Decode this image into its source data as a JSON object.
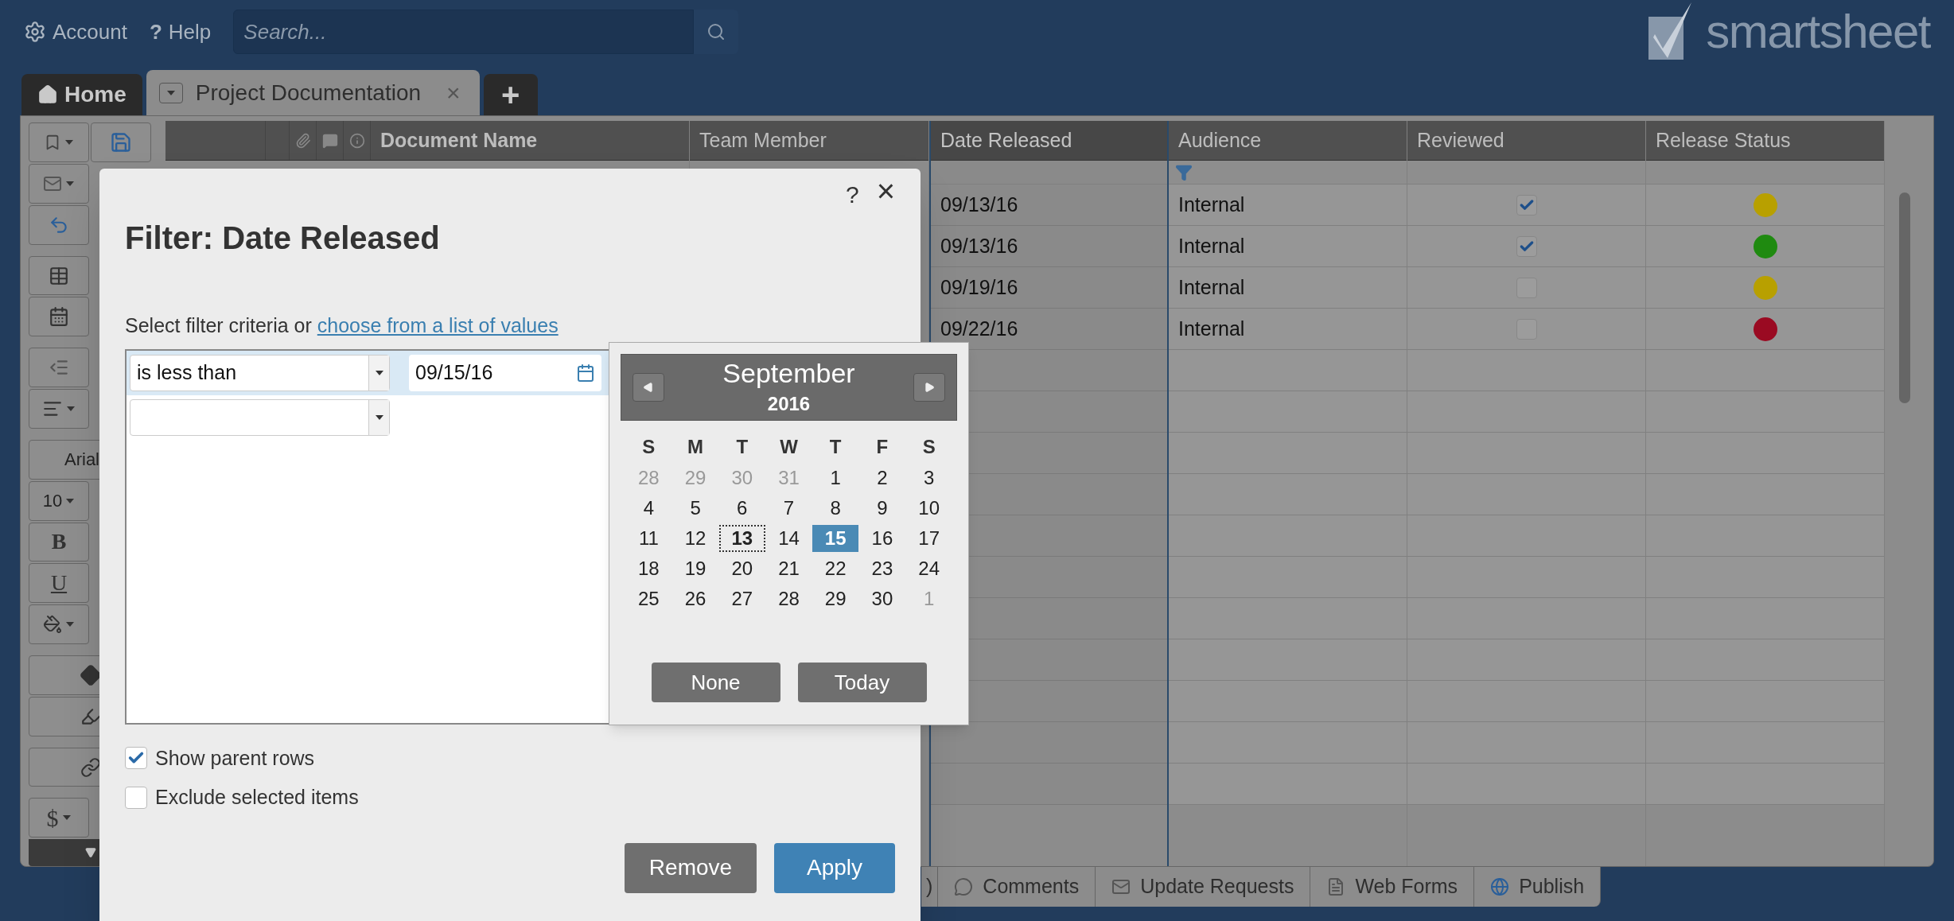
{
  "top_bar": {
    "account": "Account",
    "help_glyph": "?",
    "help": "Help",
    "search": {
      "placeholder": "Search..."
    },
    "logo": "smartsheet"
  },
  "tabs": [
    {
      "kind": "home",
      "label": "Home",
      "selected": false
    },
    {
      "kind": "sheet",
      "label": "Project Documentation",
      "close": "×",
      "selected": true
    },
    {
      "kind": "add",
      "label": "+",
      "selected": false
    }
  ],
  "toolbar": {
    "font": "Arial",
    "size": "10",
    "bold": "B",
    "underline": "U",
    "currency": "$"
  },
  "grid": {
    "columns": [
      {
        "label": "Document Name",
        "selected": false
      },
      {
        "label": "Team Member",
        "selected": false
      },
      {
        "label": "Date Released",
        "selected": true,
        "filtered": false
      },
      {
        "label": "Audience",
        "selected": false,
        "filtered": true
      },
      {
        "label": "Reviewed",
        "selected": false,
        "filtered": false
      },
      {
        "label": "Release Status",
        "selected": false,
        "filtered": false
      }
    ],
    "rows": [
      {
        "date_released": "09/13/16",
        "audience": "Internal",
        "reviewed": true,
        "color": "#b8a000"
      },
      {
        "date_released": "09/13/16",
        "audience": "Internal",
        "reviewed": true,
        "color": "#1f8a10"
      },
      {
        "date_released": "09/19/16",
        "audience": "Internal",
        "reviewed": false,
        "color": "#b8a000"
      },
      {
        "date_released": "09/22/16",
        "audience": "Internal",
        "reviewed": false,
        "color": "#9a0a22"
      }
    ]
  },
  "bottom_tabs": [
    {
      "kind": "attachments",
      "label": ")"
    },
    {
      "kind": "comments",
      "label": "Comments"
    },
    {
      "kind": "update",
      "label": "Update Requests"
    },
    {
      "kind": "forms",
      "label": "Web Forms"
    },
    {
      "kind": "publish",
      "label": "Publish"
    }
  ],
  "dialog": {
    "help": "?",
    "close": "×",
    "title": "Filter: Date Released",
    "prompt": "Select filter criteria or ",
    "link": "choose from a list of values",
    "conditions": [
      {
        "operator": "is less than",
        "value": "09/15/16",
        "selected": true
      },
      {
        "selected": false
      }
    ],
    "options": [
      {
        "label": "Show parent rows",
        "checked": true
      },
      {
        "label": "Exclude selected items",
        "checked": false
      }
    ],
    "buttons": [
      {
        "kind": "secondary",
        "label": "Remove"
      },
      {
        "kind": "primary",
        "label": "Apply"
      }
    ]
  },
  "calendar": {
    "month": "September",
    "year": "2016",
    "weekdays": [
      "S",
      "M",
      "T",
      "W",
      "T",
      "F",
      "S"
    ],
    "days": [
      {
        "label": "28",
        "outside": true,
        "today": false,
        "selected": false
      },
      {
        "label": "29",
        "outside": true,
        "today": false,
        "selected": false
      },
      {
        "label": "30",
        "outside": true,
        "today": false,
        "selected": false
      },
      {
        "label": "31",
        "outside": true,
        "today": false,
        "selected": false
      },
      {
        "label": "1",
        "outside": false,
        "today": false,
        "selected": false
      },
      {
        "label": "2",
        "outside": false,
        "today": false,
        "selected": false
      },
      {
        "label": "3",
        "outside": false,
        "today": false,
        "selected": false
      },
      {
        "label": "4",
        "outside": false,
        "today": false,
        "selected": false
      },
      {
        "label": "5",
        "outside": false,
        "today": false,
        "selected": false
      },
      {
        "label": "6",
        "outside": false,
        "today": false,
        "selected": false
      },
      {
        "label": "7",
        "outside": false,
        "today": false,
        "selected": false
      },
      {
        "label": "8",
        "outside": false,
        "today": false,
        "selected": false
      },
      {
        "label": "9",
        "outside": false,
        "today": false,
        "selected": false
      },
      {
        "label": "10",
        "outside": false,
        "today": false,
        "selected": false
      },
      {
        "label": "11",
        "outside": false,
        "today": false,
        "selected": false
      },
      {
        "label": "12",
        "outside": false,
        "today": false,
        "selected": false
      },
      {
        "label": "13",
        "outside": false,
        "today": true,
        "selected": false
      },
      {
        "label": "14",
        "outside": false,
        "today": false,
        "selected": false
      },
      {
        "label": "15",
        "outside": false,
        "today": false,
        "selected": true
      },
      {
        "label": "16",
        "outside": false,
        "today": false,
        "selected": false
      },
      {
        "label": "17",
        "outside": false,
        "today": false,
        "selected": false
      },
      {
        "label": "18",
        "outside": false,
        "today": false,
        "selected": false
      },
      {
        "label": "19",
        "outside": false,
        "today": false,
        "selected": false
      },
      {
        "label": "20",
        "outside": false,
        "today": false,
        "selected": false
      },
      {
        "label": "21",
        "outside": false,
        "today": false,
        "selected": false
      },
      {
        "label": "22",
        "outside": false,
        "today": false,
        "selected": false
      },
      {
        "label": "23",
        "outside": false,
        "today": false,
        "selected": false
      },
      {
        "label": "24",
        "outside": false,
        "today": false,
        "selected": false
      },
      {
        "label": "25",
        "outside": false,
        "today": false,
        "selected": false
      },
      {
        "label": "26",
        "outside": false,
        "today": false,
        "selected": false
      },
      {
        "label": "27",
        "outside": false,
        "today": false,
        "selected": false
      },
      {
        "label": "28",
        "outside": false,
        "today": false,
        "selected": false
      },
      {
        "label": "29",
        "outside": false,
        "today": false,
        "selected": false
      },
      {
        "label": "30",
        "outside": false,
        "today": false,
        "selected": false
      },
      {
        "label": "1",
        "outside": true,
        "today": false,
        "selected": false
      }
    ],
    "buttons": [
      "None",
      "Today"
    ]
  }
}
